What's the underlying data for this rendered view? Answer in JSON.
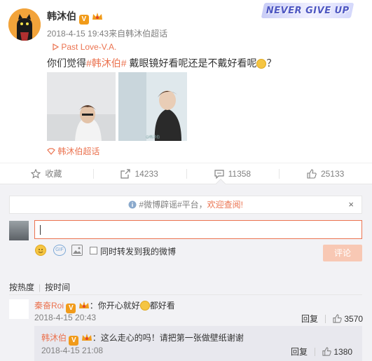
{
  "banner": {
    "text": "NEVER GIVE UP"
  },
  "post": {
    "username": "韩沐伯",
    "vip_badge": "V",
    "meta": "2018-4-15 19:43来自韩沐伯超话",
    "music": "Past Love-V.A.",
    "text_prefix": "你们觉得",
    "hashtag": "#韩沐伯#",
    "text_suffix": " 戴眼镜好看呢还是不戴好看呢",
    "text_end": "？",
    "chaohua": "韩沐伯超话"
  },
  "actions": {
    "favorite": "收藏",
    "forward_count": "14233",
    "comment_count": "11358",
    "like_count": "25133"
  },
  "comment_box": {
    "notice_prefix": "#微博辟谣#平台，",
    "notice_link": "欢迎查阅!",
    "close": "×",
    "gif_label": "GIF",
    "forward_label": "同时转发到我的微博",
    "submit_label": "评论"
  },
  "sort": {
    "hot": "按热度",
    "time": "按时间"
  },
  "comments": [
    {
      "user": "秦奋Roi",
      "vip_badge": "V",
      "text_a": "：你开心就好",
      "text_b": "都好看",
      "time": "2018-4-15 20:43",
      "reply_label": "回复",
      "likes": "3570"
    }
  ],
  "reply": {
    "user": "韩沐伯",
    "vip_badge": "V",
    "text": "：这么走心的吗！请把第一张做壁纸谢谢",
    "time": "2018-4-15 21:08",
    "reply_label": "回复",
    "likes": "1380"
  },
  "colors": {
    "accent": "#eb7350",
    "vip": "#f19b1a",
    "comment_bg": "#f2f2f5"
  }
}
